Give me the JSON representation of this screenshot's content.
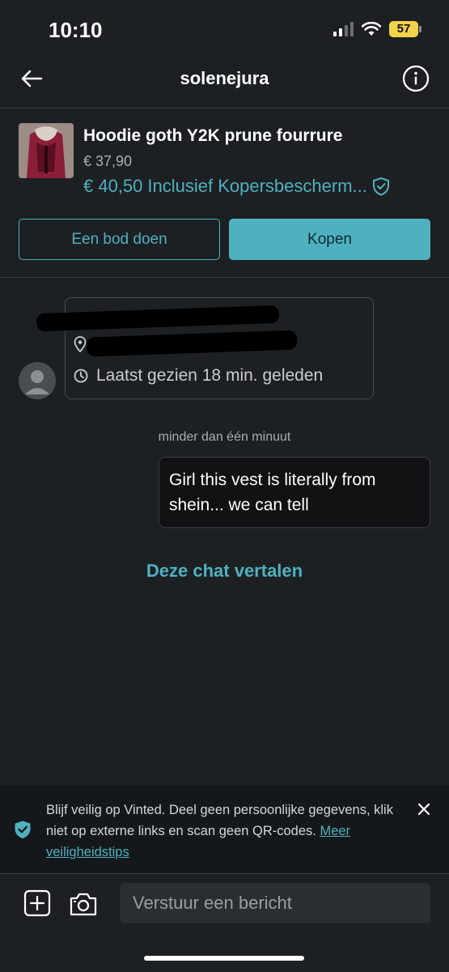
{
  "status_bar": {
    "time": "10:10",
    "battery": "57"
  },
  "header": {
    "title": "solenejura"
  },
  "item": {
    "title": "Hoodie goth Y2K prune fourrure",
    "price": "€ 37,90",
    "total_price": "€ 40,50",
    "protection_label": "Inclusief Kopersbescherm..."
  },
  "actions": {
    "offer_label": "Een bod doen",
    "buy_label": "Kopen"
  },
  "user_card": {
    "last_seen": "Laatst gezien 18 min. geleden"
  },
  "messages": [
    {
      "timestamp": "minder dan één minuut",
      "text": "Girl this vest is literally from shein... we can tell"
    }
  ],
  "translate_label": "Deze chat vertalen",
  "safety_banner": {
    "text": "Blijf veilig op Vinted. Deel geen persoonlijke gegevens, klik niet op externe links en scan geen QR-codes.",
    "link": "Meer veiligheidstips"
  },
  "composer": {
    "placeholder": "Verstuur een bericht"
  },
  "colors": {
    "accent": "#4fb1bf",
    "background": "#1d2023"
  }
}
